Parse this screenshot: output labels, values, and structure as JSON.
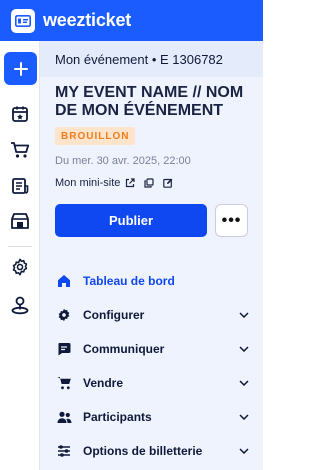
{
  "brand": {
    "name": "weezticket"
  },
  "event": {
    "header": "Mon événement • E 1306782",
    "title": "MY EVENT NAME // NOM DE MON ÉVÉNEMENT",
    "status": "BROUILLON",
    "date": "Du mer. 30 avr. 2025, 22:00",
    "minisite_label": "Mon mini-site",
    "publish_label": "Publier",
    "more_label": "•••"
  },
  "rail": {
    "icons": [
      "plus-icon",
      "calendar-star-icon",
      "cart-icon",
      "invoice-icon",
      "store-icon",
      "gear-icon",
      "map-pin-icon"
    ]
  },
  "nav": {
    "items": [
      {
        "label": "Tableau de bord",
        "icon": "home-icon",
        "active": true
      },
      {
        "label": "Configurer",
        "icon": "gear-icon"
      },
      {
        "label": "Communiquer",
        "icon": "chat-icon"
      },
      {
        "label": "Vendre",
        "icon": "cart-icon"
      },
      {
        "label": "Participants",
        "icon": "people-icon"
      },
      {
        "label": "Options de billetterie",
        "icon": "sliders-icon"
      }
    ]
  },
  "colors": {
    "primary": "#1a5cff",
    "publish": "#0f47f0",
    "badge_bg": "#ffe4cc",
    "badge_text": "#f07d1e"
  }
}
